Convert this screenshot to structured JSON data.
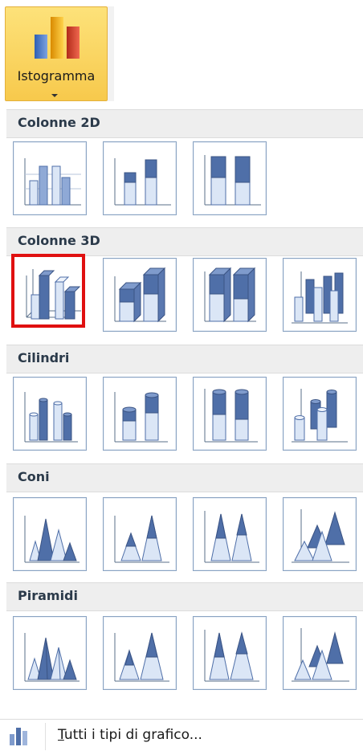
{
  "ribbon": {
    "button_label": "Istogramma",
    "icon": "column-chart-icon"
  },
  "sections": [
    {
      "title": "Colonne 2D",
      "items": [
        "column-2d-clustered",
        "column-2d-stacked",
        "column-2d-100-stacked"
      ]
    },
    {
      "title": "Colonne 3D",
      "items": [
        "column-3d-clustered",
        "column-3d-stacked",
        "column-3d-100-stacked",
        "column-3d"
      ],
      "selected_index": 0
    },
    {
      "title": "Cilindri",
      "items": [
        "cylinder-clustered",
        "cylinder-stacked",
        "cylinder-100-stacked",
        "cylinder-3d"
      ]
    },
    {
      "title": "Coni",
      "items": [
        "cone-clustered",
        "cone-stacked",
        "cone-100-stacked",
        "cone-3d"
      ]
    },
    {
      "title": "Piramidi",
      "items": [
        "pyramid-clustered",
        "pyramid-stacked",
        "pyramid-100-stacked",
        "pyramid-3d"
      ]
    }
  ],
  "footer": {
    "label_mnemonic": "T",
    "label_rest": "utti i tipi di grafico...",
    "icon": "all-chart-types-icon"
  },
  "colors": {
    "ribbon_active": "#f7c94c",
    "tile_border": "#8aa3c2",
    "selection": "#e01010",
    "bar_dark": "#4f6fa8",
    "bar_light": "#c9d8ef"
  }
}
